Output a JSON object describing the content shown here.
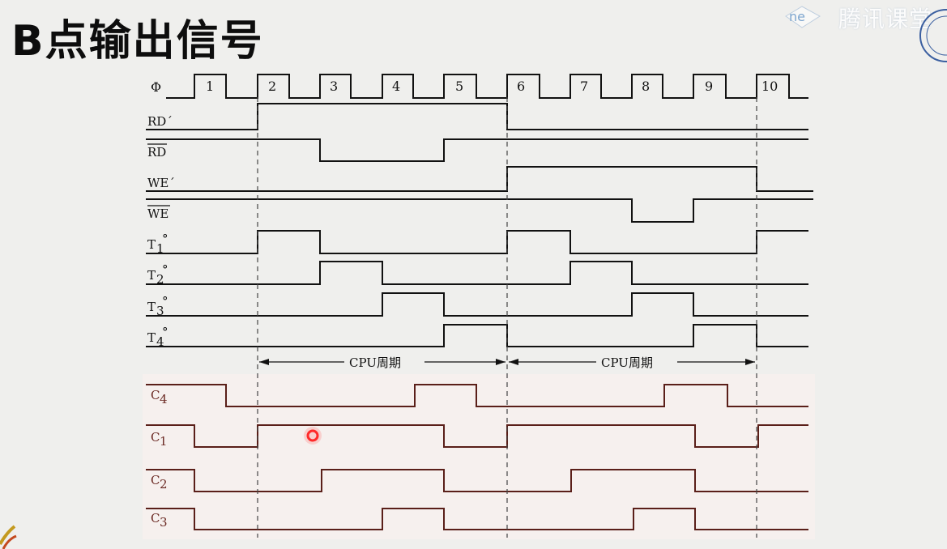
{
  "title": "B点输出信号",
  "watermark": {
    "text": "腾讯课堂",
    "logo_text": "ne"
  },
  "clock": {
    "label": "Φ",
    "numbers": [
      "1",
      "2",
      "3",
      "4",
      "5",
      "6",
      "7",
      "8",
      "9",
      "10"
    ]
  },
  "signals": {
    "rd_prime": "RD´",
    "rd_bar": "RD",
    "we_prime": "WE´",
    "we_bar": "WE",
    "t1": "T",
    "t1_sub": "1",
    "t2": "T",
    "t2_sub": "2",
    "t3": "T",
    "t3_sub": "3",
    "t4": "T",
    "t4_sub": "4",
    "deg": "°"
  },
  "cycles": {
    "label1": "CPU周期",
    "label2": "CPU周期"
  },
  "lower_signals": {
    "c4": "C",
    "c4_sub": "4",
    "c1": "C",
    "c1_sub": "1",
    "c2": "C",
    "c2_sub": "2",
    "c3": "C",
    "c3_sub": "3"
  },
  "colors": {
    "upper_wave": "#111111",
    "lower_wave": "#5a1f19",
    "pointer": "#ff2a2a"
  }
}
